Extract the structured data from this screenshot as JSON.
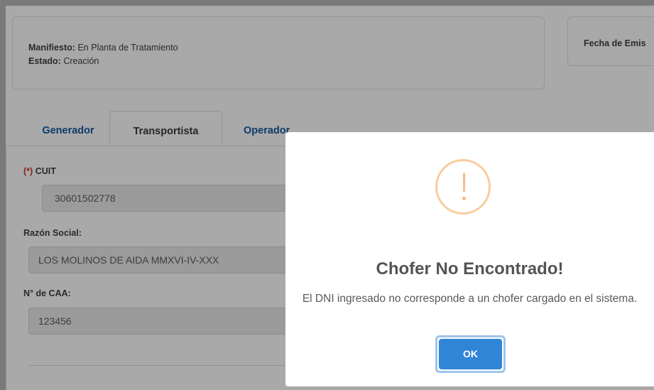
{
  "header": {
    "manifest_label": "Manifiesto:",
    "manifest_value": "En Planta de Tratamiento",
    "status_label": "Estado:",
    "status_value": "Creación",
    "date_label": "Fecha de Emis"
  },
  "tabs": [
    {
      "label": "Generador"
    },
    {
      "label": "Transportista"
    },
    {
      "label": "Operador"
    }
  ],
  "form": {
    "cuit_required": "(*)",
    "cuit_label": "CUIT",
    "cuit_value": "30601502778",
    "razon_label": "Razón Social:",
    "razon_value": "LOS MOLINOS DE AIDA MMXVI-IV-XXX",
    "caa_label": "N° de CAA:",
    "caa_value": "123456"
  },
  "modal": {
    "icon": "warning-icon",
    "title": "Chofer No Encontrado!",
    "text": "El DNI ingresado no corresponde a un chofer cargado en el sistema.",
    "button": "OK"
  },
  "colors": {
    "tab_link": "#0c3c6a",
    "ok_button": "#3085d6",
    "warning": "#f8bb86"
  }
}
